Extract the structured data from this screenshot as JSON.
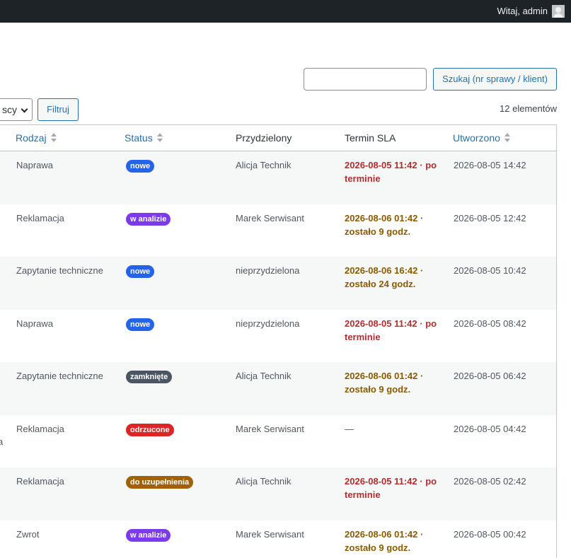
{
  "admin_bar": {
    "greeting": "Witaj, admin"
  },
  "toolbar": {
    "search_value": "",
    "search_button": "Szukaj (nr sprawy / klient)",
    "filter_select_value": "scy",
    "filter_button": "Filtruj",
    "items_count": "12 elementów"
  },
  "table": {
    "columns": [
      {
        "label": "Rodzaj",
        "sortable": true
      },
      {
        "label": "Status",
        "sortable": true
      },
      {
        "label": "Przydzielony",
        "sortable": false
      },
      {
        "label": "Termin SLA",
        "sortable": false
      },
      {
        "label": "Utworzono",
        "sortable": true
      }
    ],
    "rows": [
      {
        "type": "Naprawa",
        "status": "nowe",
        "status_color": "#2563eb",
        "assigned": "Alicja Technik",
        "sla_line1": "2026-08-05 11:42 · po",
        "sla_line2": "terminie",
        "sla_state": "overdue",
        "created": "2026-08-05 14:42",
        "edge": ""
      },
      {
        "type": "Reklamacja",
        "status": "w analizie",
        "status_color": "#7c3aed",
        "assigned": "Marek Serwisant",
        "sla_line1": "2026-08-06 01:42 ·",
        "sla_line2": "zostało 9 godz.",
        "sla_state": "ok",
        "created": "2026-08-05 12:42",
        "edge": ""
      },
      {
        "type": "Zapytanie techniczne",
        "status": "nowe",
        "status_color": "#2563eb",
        "assigned": "nieprzydzielona",
        "sla_line1": "2026-08-06 16:42 ·",
        "sla_line2": "zostało 24 godz.",
        "sla_state": "ok",
        "created": "2026-08-05 10:42",
        "edge": ":"
      },
      {
        "type": "Naprawa",
        "status": "nowe",
        "status_color": "#2563eb",
        "assigned": "nieprzydzielona",
        "sla_line1": "2026-08-05 11:42 · po",
        "sla_line2": "terminie",
        "sla_state": "overdue",
        "created": "2026-08-05 08:42",
        "edge": "."
      },
      {
        "type": "Zapytanie techniczne",
        "status": "zamknięte",
        "status_color": "#4b5563",
        "assigned": "Alicja Technik",
        "sla_line1": "2026-08-06 01:42 ·",
        "sla_line2": "zostało 9 godz.",
        "sla_state": "ok",
        "created": "2026-08-05 06:42",
        "edge": ""
      },
      {
        "type": "Reklamacja",
        "status": "odrzucone",
        "status_color": "#dc2626",
        "assigned": "Marek Serwisant",
        "sla_line1": "—",
        "sla_line2": "",
        "sla_state": "none",
        "created": "2026-08-05 04:42",
        "edge": "a"
      },
      {
        "type": "Reklamacja",
        "status": "do uzupełnienia",
        "status_color": "#a16207",
        "assigned": "Alicja Technik",
        "sla_line1": "2026-08-05 11:42 · po",
        "sla_line2": "terminie",
        "sla_state": "overdue",
        "created": "2026-08-05 02:42",
        "edge": ""
      },
      {
        "type": "Zwrot",
        "status": "w analizie",
        "status_color": "#7c3aed",
        "assigned": "Marek Serwisant",
        "sla_line1": "2026-08-06 01:42 ·",
        "sla_line2": "zostało 9 godz.",
        "sla_state": "ok",
        "created": "2026-08-05 00:42",
        "edge": ""
      }
    ]
  }
}
